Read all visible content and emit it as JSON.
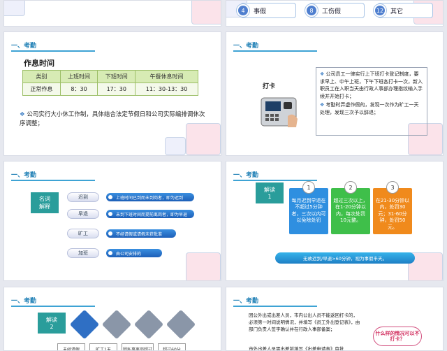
{
  "slide_top_left": {
    "label": ""
  },
  "slide_top_right": {
    "items": [
      {
        "num": "4",
        "label": "事假"
      },
      {
        "num": "8",
        "label": "工伤假"
      },
      {
        "num": "12",
        "label": "其它"
      }
    ]
  },
  "section_title": "一、考勤",
  "slide2": {
    "heading": "作息时间",
    "table": {
      "headers": [
        "类别",
        "上班时间",
        "下班时间",
        "午餐休息时间"
      ],
      "rows": [
        [
          "正常作息",
          "8：30",
          "17：30",
          "11：30-13：30"
        ]
      ]
    },
    "bullet": "公司实行大小休工作制，具体结合法定节假日和公司实际编排调休次序调整；"
  },
  "slide3": {
    "punch_label": "打卡",
    "bullets": [
      "公司员工一律实行上下班打卡登记制度，要求早上、中午上班，下午下班各打卡一次，新入职员工在入职当天由行政人事部办理指纹输入手续并开始打卡；",
      "考勤时弄虚作假的，发现一次作为旷工一天处理，发现三次予以辞退；"
    ]
  },
  "slide4": {
    "term_label": [
      "名词",
      "解释"
    ],
    "terms": [
      {
        "name": "迟到",
        "desc": "上班时间已到而未到岗者，即为迟到"
      },
      {
        "name": "早退",
        "desc": "未到下班时间而提前离岗者，即为早退"
      },
      {
        "name": "旷工",
        "desc": "不经请假或请假未获批准"
      },
      {
        "name": "加班",
        "desc": "由公司安排的"
      }
    ]
  },
  "slide5": {
    "label": [
      "解读",
      "1"
    ],
    "cards": [
      {
        "num": "1",
        "text": "每月迟到早退在不超过5分钟者，三次以内可以免除处罚",
        "color": "#2f8fe0"
      },
      {
        "num": "2",
        "text": "超过三次以上，在1-20分钟以内，每次处罚10元整。",
        "color": "#3fbf4a"
      },
      {
        "num": "3",
        "text": "在21-30分钟以内，处罚30元；31-60分钟，处罚50元。",
        "color": "#f08a1c"
      }
    ],
    "footer": "无故迟到/早退>60分钟，视为事假半天。"
  },
  "slide6": {
    "label": [
      "解读",
      "2"
    ],
    "boxes": [
      "未经请假",
      "旷工1天",
      "因私事离岗超过",
      "超过60分"
    ]
  },
  "slide7": {
    "para1": "因公外出或出差人员，市内公出人员不能返回打卡的，必须第一时间说明情况，并填写《员工外出登记表》，由部门负责人签字确认并在行政人事部备案；",
    "para2": "市外出差人员需出差前填写《出差申请表》审批",
    "cloud": "什么样的情况可以不打卡？"
  }
}
